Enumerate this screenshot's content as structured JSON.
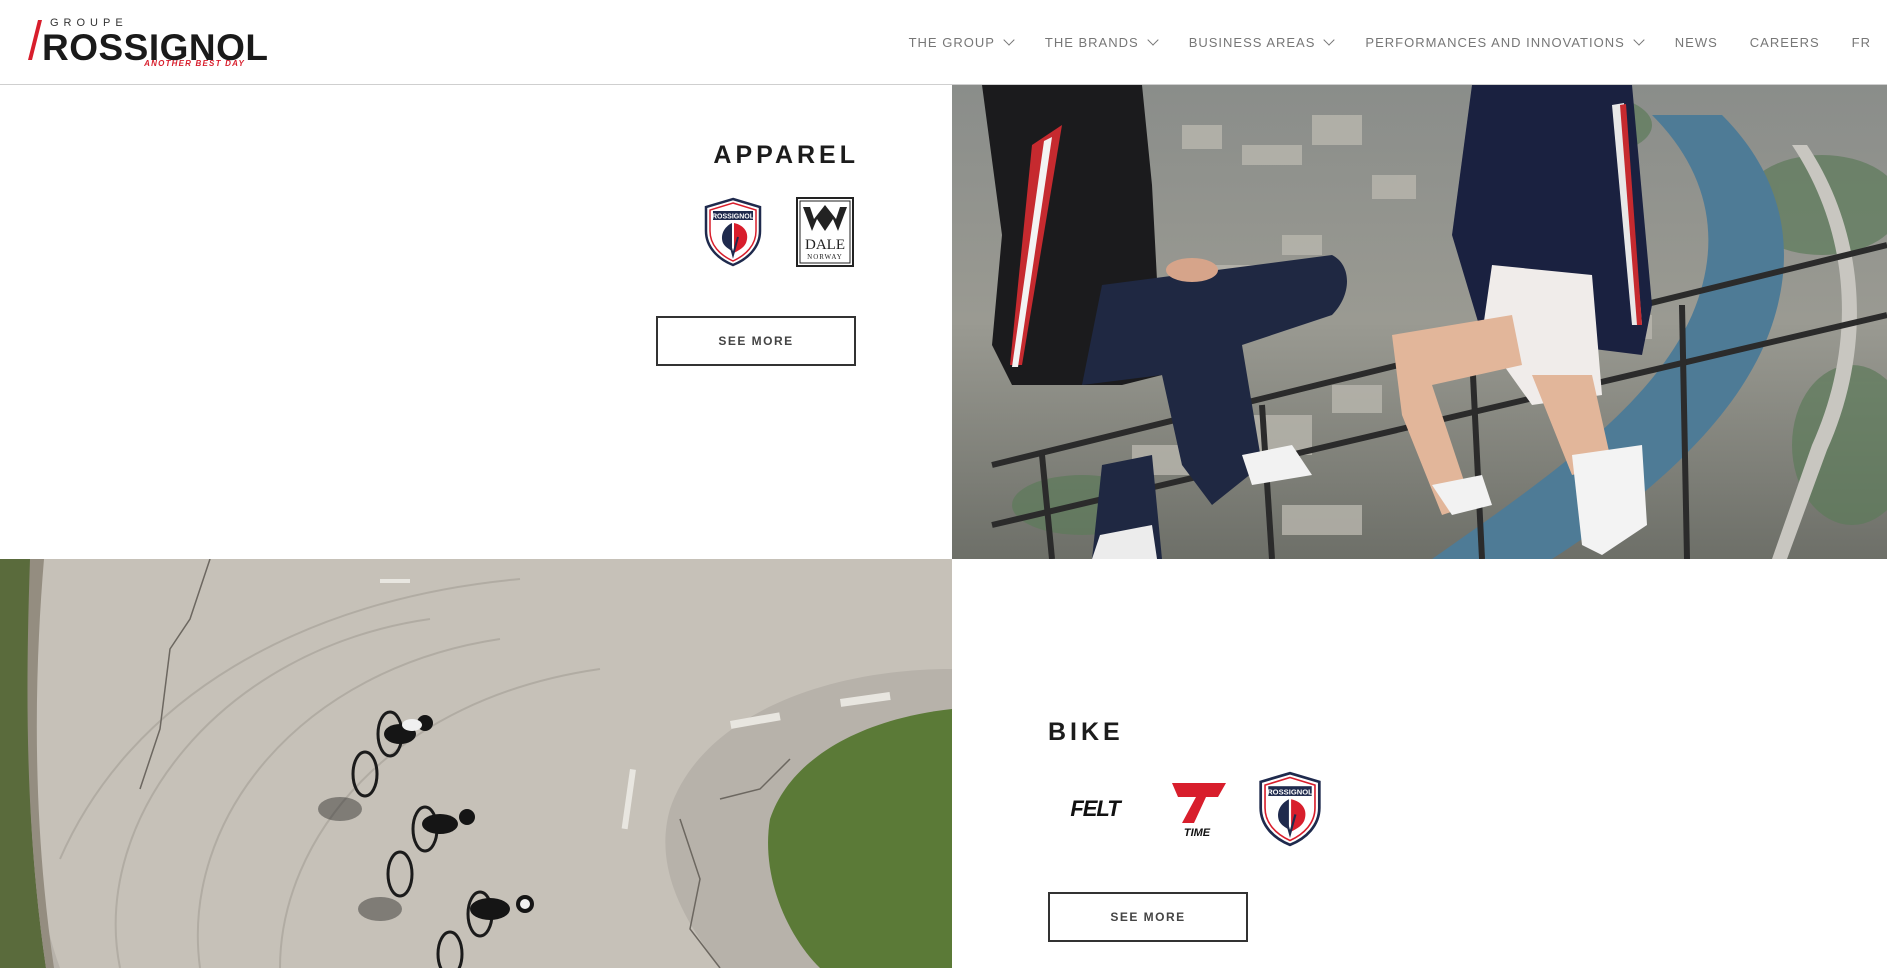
{
  "header": {
    "logo": {
      "groupe": "GROUPE",
      "name": "ROSSIGNOL",
      "tagline": "ANOTHER BEST DAY"
    },
    "nav": [
      {
        "label": "THE GROUP",
        "has_dropdown": true
      },
      {
        "label": "THE BRANDS",
        "has_dropdown": true
      },
      {
        "label": "BUSINESS AREAS",
        "has_dropdown": true
      },
      {
        "label": "PERFORMANCES AND INNOVATIONS",
        "has_dropdown": true
      },
      {
        "label": "NEWS",
        "has_dropdown": false
      },
      {
        "label": "CAREERS",
        "has_dropdown": false
      },
      {
        "label": "FR",
        "has_dropdown": false
      }
    ]
  },
  "apparel": {
    "title": "APPAREL",
    "brands": [
      {
        "name": "Rossignol",
        "label": "ROSSIGNOL"
      },
      {
        "name": "Dale of Norway",
        "label_top": "DALE",
        "label_bottom": "NORWAY"
      }
    ],
    "button": "SEE MORE"
  },
  "bike": {
    "title": "BIKE",
    "brands": [
      {
        "name": "Felt",
        "label": "FELT"
      },
      {
        "name": "Time",
        "label": "TIME"
      },
      {
        "name": "Rossignol",
        "label": "ROSSIGNOL"
      }
    ],
    "button": "SEE MORE"
  },
  "colors": {
    "brand_red": "#d81e2c",
    "brand_navy": "#1f2a4d",
    "nav_text": "#777777"
  }
}
